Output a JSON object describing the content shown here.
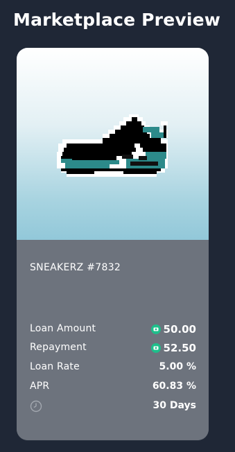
{
  "header": {
    "title": "Marketplace Preview"
  },
  "card": {
    "image_icon": "pixel-sneaker",
    "name": "SNEAKERZ #7832",
    "loan_amount": {
      "label": "Loan Amount",
      "value": "50.00",
      "token_icon": "token-icon"
    },
    "repayment": {
      "label": "Repayment",
      "value": "52.50",
      "token_icon": "token-icon"
    },
    "loan_rate": {
      "label": "Loan Rate",
      "value": "5.00 %"
    },
    "apr": {
      "label": "APR",
      "value": "60.83 %"
    },
    "duration": {
      "icon": "clock-icon",
      "value": "30 Days"
    }
  },
  "colors": {
    "background": "#1f2736",
    "card_body": "#6d737d",
    "accent": "#1ebf8b",
    "teal": "#2c8a8a"
  }
}
